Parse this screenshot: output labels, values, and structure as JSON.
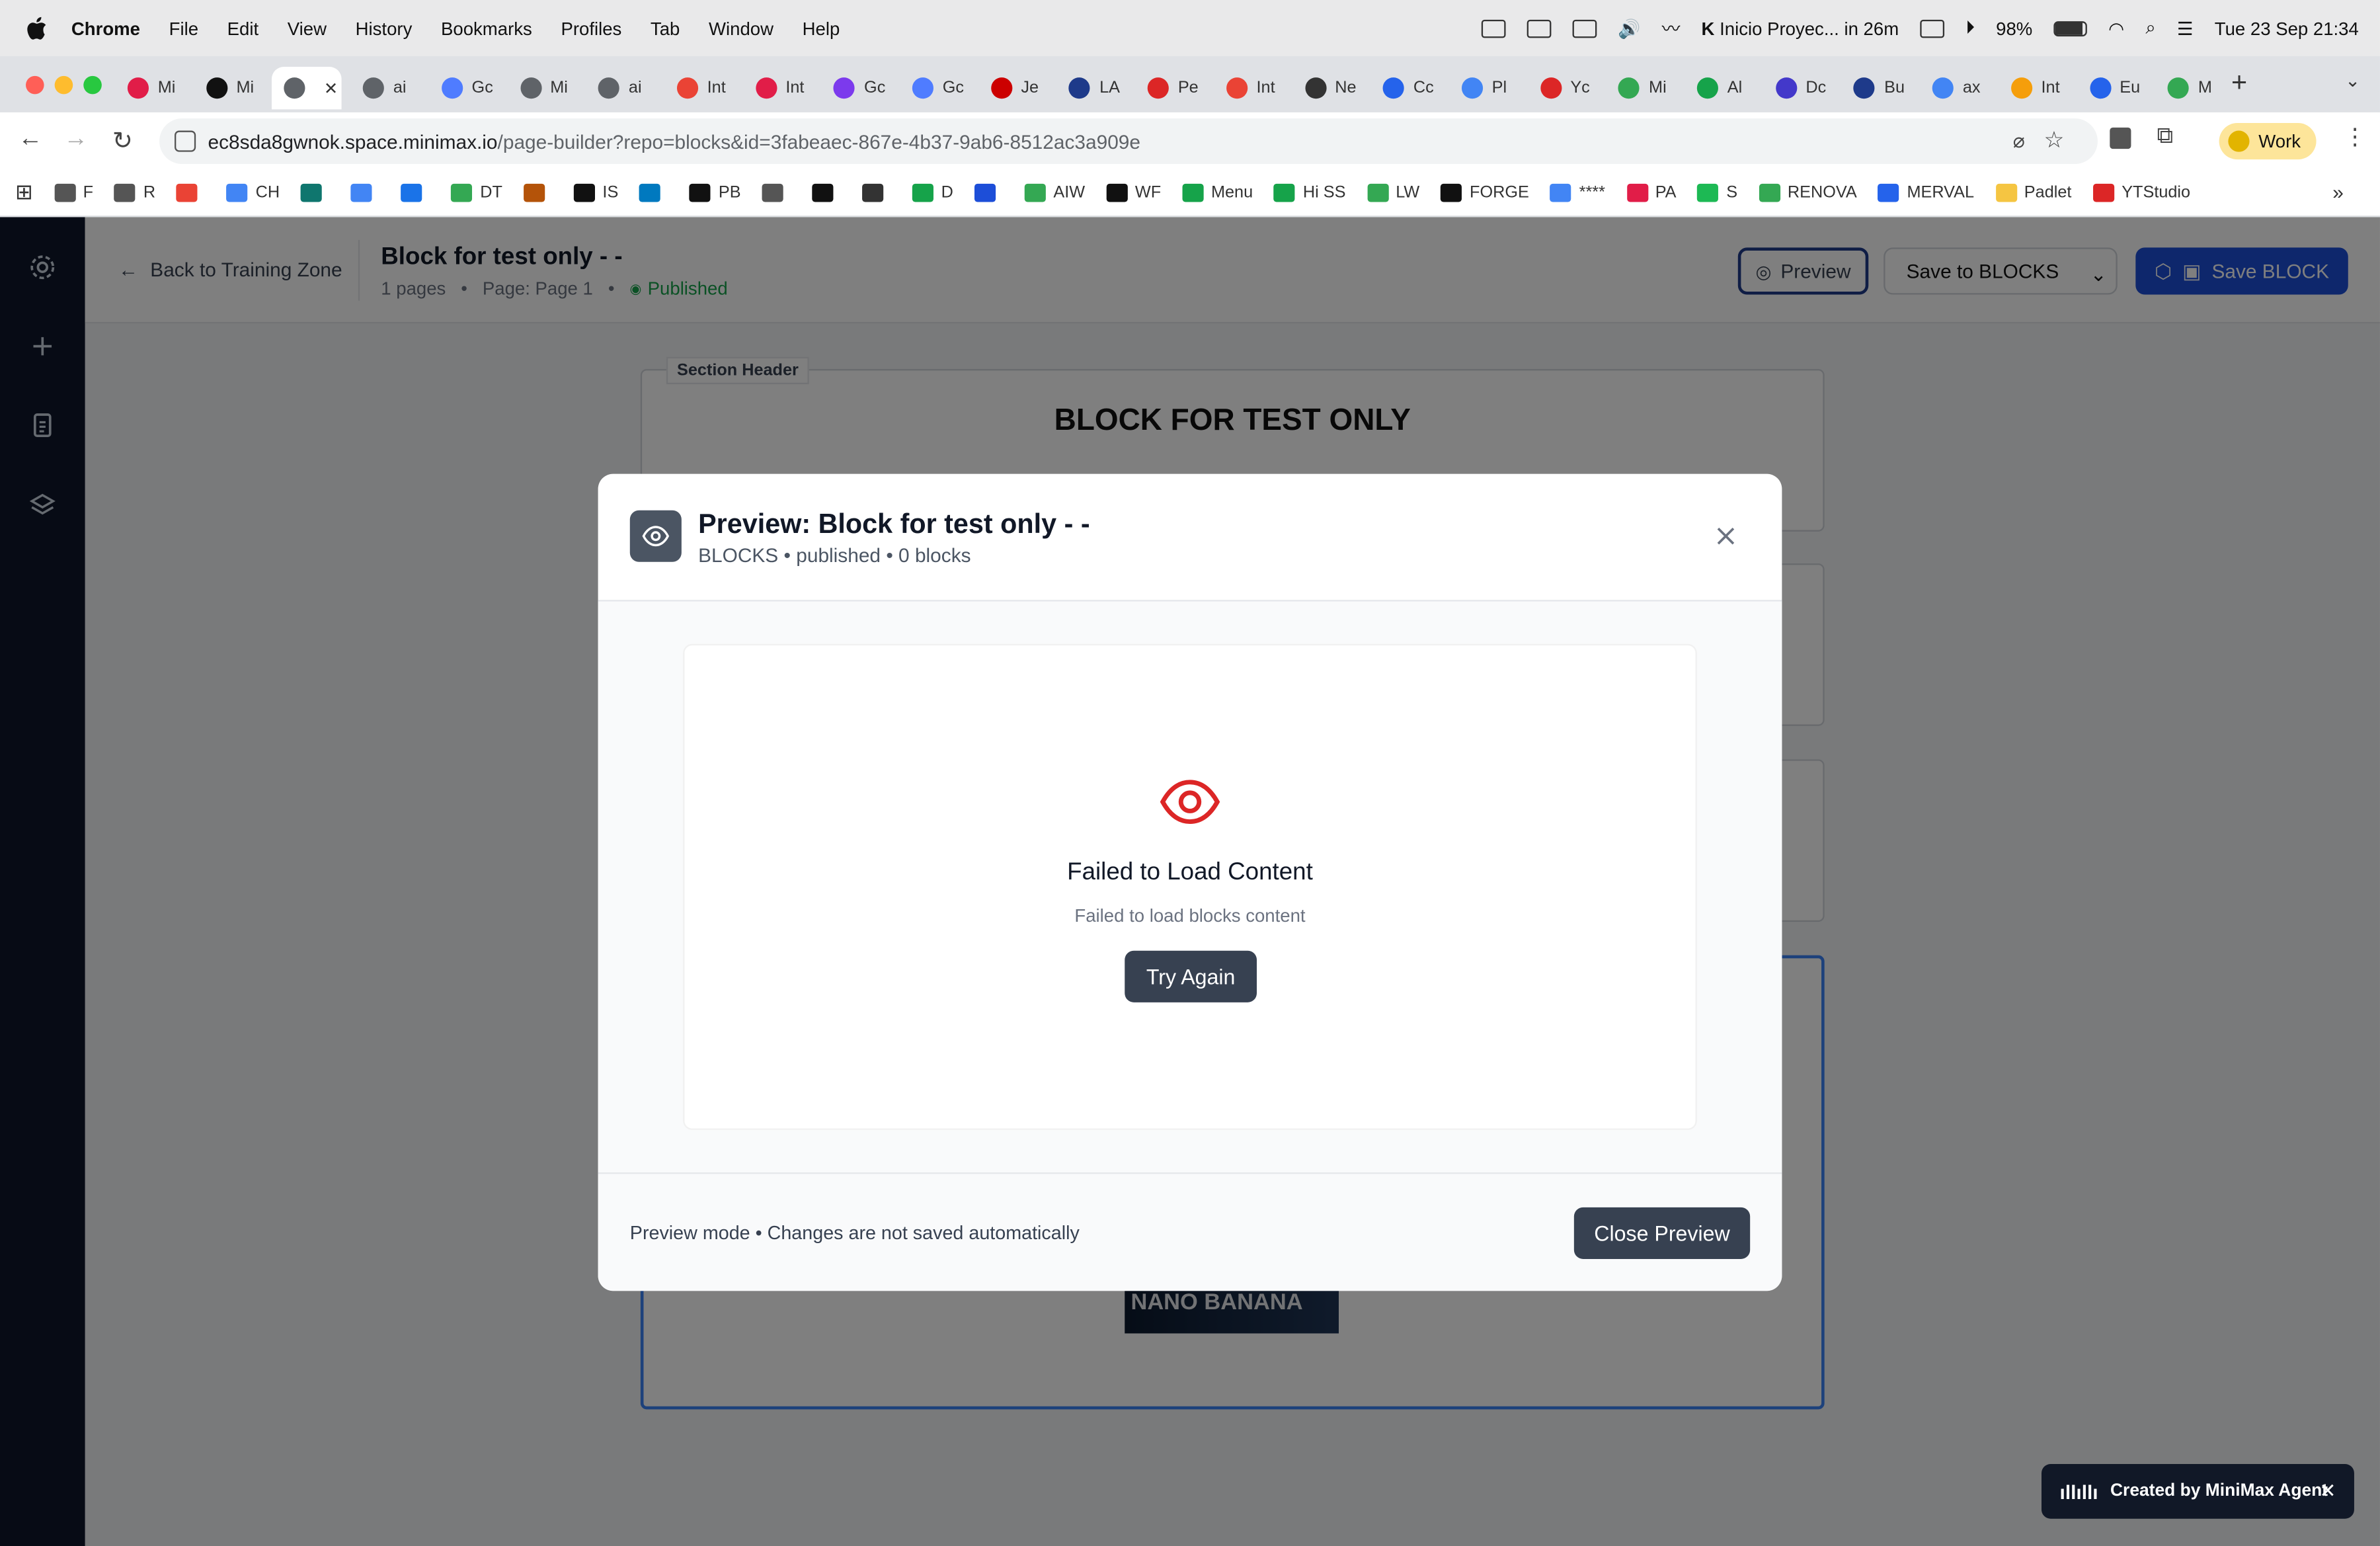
{
  "menubar": {
    "app": "Chrome",
    "items": [
      "File",
      "Edit",
      "View",
      "History",
      "Bookmarks",
      "Profiles",
      "Tab",
      "Window",
      "Help"
    ],
    "event": "Inicio Proyec... in 26m",
    "battery": "98%",
    "clock": "Tue 23 Sep  21:34"
  },
  "tabs": [
    {
      "label": "Mi",
      "color": "#e11d48"
    },
    {
      "label": "Mi",
      "color": "#111111"
    },
    {
      "label": "",
      "color": "#5f6368",
      "active": true
    },
    {
      "label": "ai",
      "color": "#5f6368"
    },
    {
      "label": "Gc",
      "color": "#4f7cff"
    },
    {
      "label": "Mi",
      "color": "#5f6368"
    },
    {
      "label": "ai",
      "color": "#5f6368"
    },
    {
      "label": "Int",
      "color": "#ea4335"
    },
    {
      "label": "Int",
      "color": "#e11d48"
    },
    {
      "label": "Gc",
      "color": "#7c3aed"
    },
    {
      "label": "Gc",
      "color": "#4f7cff"
    },
    {
      "label": "Je",
      "color": "#cc0000"
    },
    {
      "label": "LA",
      "color": "#1e3a8a"
    },
    {
      "label": "Pe",
      "color": "#dc2626"
    },
    {
      "label": "Int",
      "color": "#ea4335"
    },
    {
      "label": "Ne",
      "color": "#333333"
    },
    {
      "label": "Cc",
      "color": "#2563eb"
    },
    {
      "label": "Pl",
      "color": "#4285f4"
    },
    {
      "label": "Yc",
      "color": "#dc2626"
    },
    {
      "label": "Mi",
      "color": "#34a853"
    },
    {
      "label": "Al",
      "color": "#16a34a"
    },
    {
      "label": "Dc",
      "color": "#4338ca"
    },
    {
      "label": "Bu",
      "color": "#1e3a8a"
    },
    {
      "label": "ax",
      "color": "#4285f4"
    },
    {
      "label": "Int",
      "color": "#f59e0b"
    },
    {
      "label": "Eu",
      "color": "#2563eb"
    },
    {
      "label": "M",
      "color": "#34a853"
    }
  ],
  "address": {
    "host": "ec8sda8gwnok.space.minimax.io",
    "path": "/page-builder?repo=blocks&id=3fabeaec-867e-4b37-9ab6-8512ac3a909e"
  },
  "profile": "Work",
  "bookmarks": [
    {
      "label": "F",
      "color": "#555555"
    },
    {
      "label": "R",
      "color": "#555555"
    },
    {
      "label": "",
      "color": "#ea4335"
    },
    {
      "label": "CH",
      "color": "#4285f4"
    },
    {
      "label": "",
      "color": "#0f766e"
    },
    {
      "label": "",
      "color": "#4285f4"
    },
    {
      "label": "",
      "color": "#1a73e8"
    },
    {
      "label": "DT",
      "color": "#34a853"
    },
    {
      "label": "",
      "color": "#b45309"
    },
    {
      "label": "IS",
      "color": "#111111"
    },
    {
      "label": "",
      "color": "#0079bf"
    },
    {
      "label": "PB",
      "color": "#111111"
    },
    {
      "label": "",
      "color": "#555555"
    },
    {
      "label": "",
      "color": "#111111"
    },
    {
      "label": "",
      "color": "#333333"
    },
    {
      "label": "D",
      "color": "#16a34a"
    },
    {
      "label": "",
      "color": "#1d4ed8"
    },
    {
      "label": "AIW",
      "color": "#34a853"
    },
    {
      "label": "WF",
      "color": "#111111"
    },
    {
      "label": "Menu",
      "color": "#16a34a"
    },
    {
      "label": "Hi SS",
      "color": "#16a34a"
    },
    {
      "label": "LW",
      "color": "#34a853"
    },
    {
      "label": "FORGE",
      "color": "#111111"
    },
    {
      "label": "****",
      "color": "#4285f4"
    },
    {
      "label": "PA",
      "color": "#e11d48"
    },
    {
      "label": "S",
      "color": "#1db954"
    },
    {
      "label": "RENOVA",
      "color": "#34a853"
    },
    {
      "label": "MERVAL",
      "color": "#2563eb"
    },
    {
      "label": "Padlet",
      "color": "#f5c542"
    },
    {
      "label": "YTStudio",
      "color": "#dc2626"
    }
  ],
  "header": {
    "back_label": "Back to Training Zone",
    "page_title": "Block for test only - -",
    "pages_count": "1 pages",
    "page_name": "Page: Page 1",
    "status": "Published",
    "preview_label": "Preview",
    "save_select_value": "Save to BLOCKS",
    "save_block_label": "Save BLOCK"
  },
  "canvas": {
    "section_tag": "Section Header",
    "block_title": "BLOCK FOR TEST ONLY",
    "thumb_text": "NANO BANANA"
  },
  "modal": {
    "title": "Preview: Block for test only - -",
    "subtitle": "BLOCKS • published • 0 blocks",
    "error_title": "Failed to Load Content",
    "error_message": "Failed to load blocks content",
    "retry_label": "Try Again",
    "footer_note": "Preview mode • Changes are not saved automatically",
    "close_label": "Close Preview"
  },
  "toast": {
    "text": "Created by MiniMax Agent"
  },
  "colors": {
    "rail": "#0f172a",
    "primary": "#1d4ed8",
    "published": "#16a34a",
    "error_icon": "#dc2626",
    "dark_button": "#374151"
  }
}
